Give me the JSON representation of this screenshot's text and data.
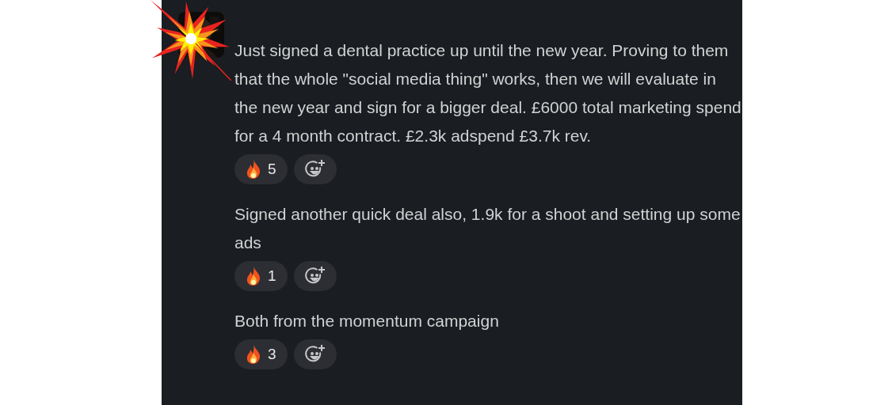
{
  "messages": [
    {
      "text": "Just signed a dental practice up until the new year. Proving to them that the whole \"social media thing\" works, then we will evaluate in the new year and sign for a bigger deal. £6000 total marketing spend for a 4 month contract. £2.3k adspend £3.7k rev.",
      "reactions": [
        {
          "count": "5"
        }
      ]
    },
    {
      "text": "Signed another quick deal also, 1.9k for a shoot and setting up some ads",
      "reactions": [
        {
          "count": "1"
        }
      ]
    },
    {
      "text": "Both from the momentum campaign",
      "reactions": [
        {
          "count": "3"
        }
      ]
    }
  ]
}
